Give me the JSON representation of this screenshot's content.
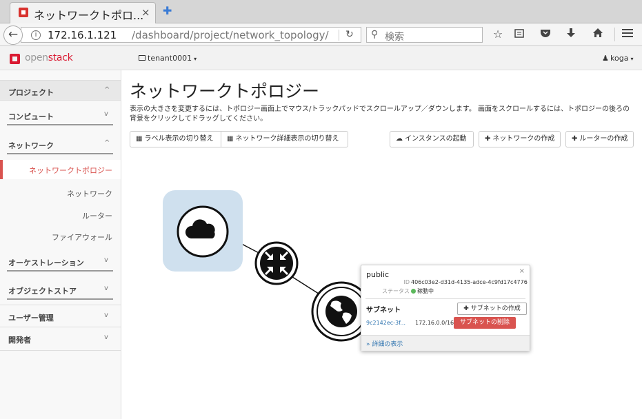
{
  "browser": {
    "tab_title": "ネットワークトポロ...",
    "tab_close": "×",
    "new_tab": "✚",
    "back": "←",
    "url_host": "172.16.1.121",
    "url_path": "/dashboard/project/network_topology/",
    "search_placeholder": "検索",
    "info": "i",
    "reload": "↻"
  },
  "header": {
    "logo_open": "open",
    "logo_stack": "stack",
    "tenant": "tenant0001",
    "user": "koga",
    "caret": "▾"
  },
  "sidebar": {
    "project": "プロジェクト",
    "compute": "コンピュート",
    "network": "ネットワーク",
    "network_items": [
      "ネットワークトポロジー",
      "ネットワーク",
      "ルーター",
      "ファイアウォール"
    ],
    "orchestration": "オーケストレーション",
    "object_store": "オブジェクトストア",
    "user_admin": "ユーザー管理",
    "developer": "開発者",
    "chev_up": "^",
    "chev_down": "v"
  },
  "main": {
    "title": "ネットワークトポロジー",
    "description": "表示の大きさを変更するには、トポロジー画面上でマウス/トラックパッドでスクロールアップ／ダウンします。 画面をスクロールするには、トポロジーの後ろの背景をクリックしてドラッグしてください。",
    "toggle_labels": "ラベル表示の切り替え",
    "toggle_details": "ネットワーク詳細表示の切り替え",
    "launch_instance": "インスタンスの起動",
    "create_network": "ネットワークの作成",
    "create_router": "ルーターの作成"
  },
  "popover": {
    "title": "public",
    "close": "×",
    "id_label": "ID",
    "id_value": "406c03e2-d31d-4135-adce-4c9fd17c4776",
    "status_label": "ステータス",
    "status_value": "稼動中",
    "subnet_heading": "サブネット",
    "create_subnet": "サブネットの作成",
    "subnet_name": "9c2142ec-3f...",
    "subnet_cidr": "172.16.0.0/16",
    "delete_subnet": "サブネットの削除",
    "view_details": "» 詳細の表示"
  },
  "colors": {
    "accent_red": "#da1a32",
    "danger": "#d9534f",
    "link": "#3276b1",
    "active_status": "#5cb85c",
    "cloud_bg": "#cfe0ee"
  }
}
